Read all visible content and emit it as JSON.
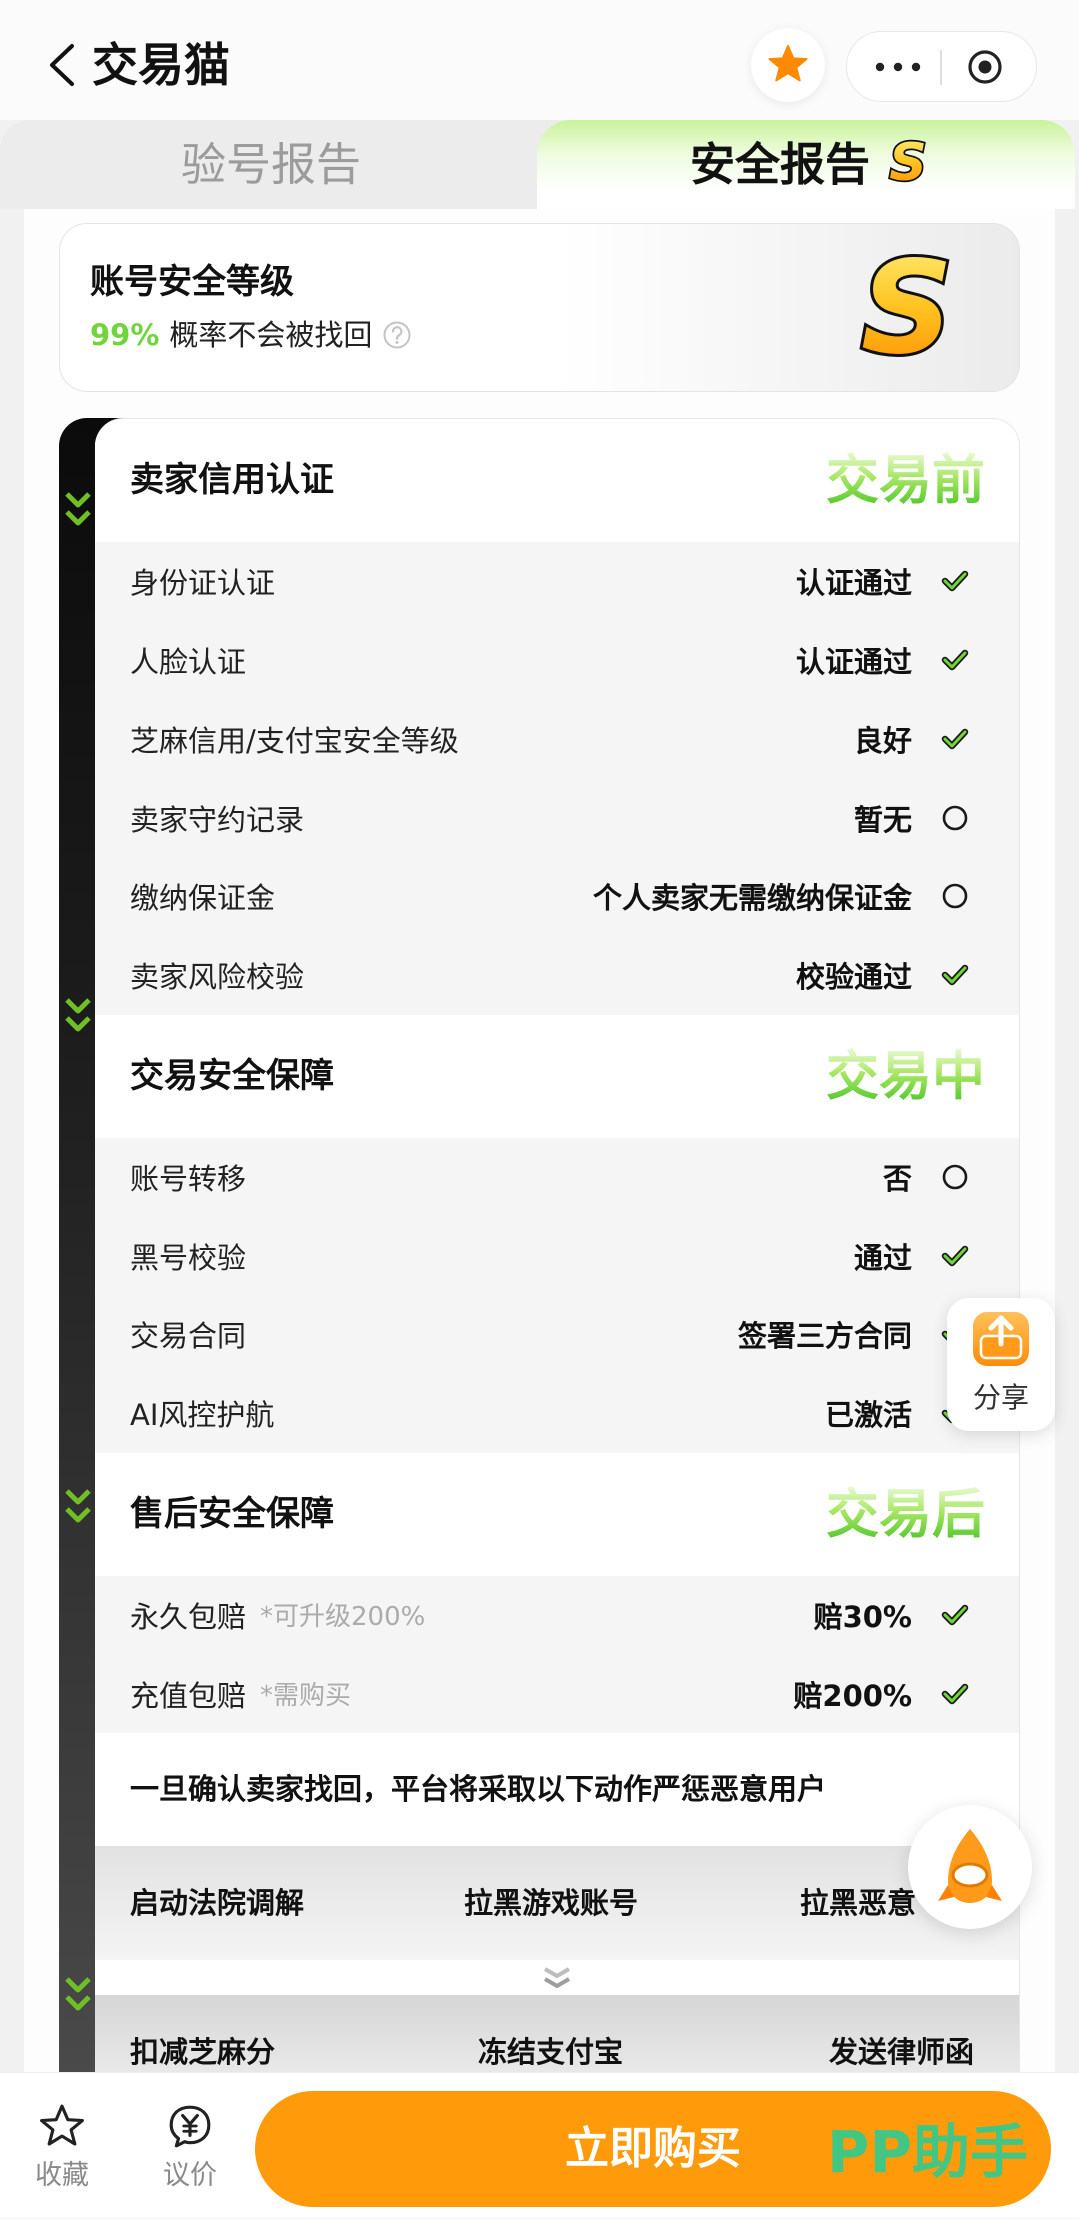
{
  "header": {
    "title": "交易猫"
  },
  "tabs": {
    "verify": "验号报告",
    "security": "安全报告",
    "security_badge": "S"
  },
  "level": {
    "title": "账号安全等级",
    "percent": "99%",
    "desc": "概率不会被找回",
    "grade": "S"
  },
  "sections": [
    {
      "title": "卖家信用认证",
      "stage": "交易前",
      "rows": [
        {
          "label": "身份证认证",
          "value": "认证通过",
          "icon": "check-icon"
        },
        {
          "label": "人脸认证",
          "value": "认证通过",
          "icon": "check-icon"
        },
        {
          "label": "芝麻信用/支付宝安全等级",
          "value": "良好",
          "icon": "check-icon"
        },
        {
          "label": "卖家守约记录",
          "value": "暂无",
          "icon": "circle-icon"
        },
        {
          "label": "缴纳保证金",
          "value": "个人卖家无需缴纳保证金",
          "icon": "circle-icon"
        },
        {
          "label": "卖家风险校验",
          "value": "校验通过",
          "icon": "check-icon"
        }
      ]
    },
    {
      "title": "交易安全保障",
      "stage": "交易中",
      "rows": [
        {
          "label": "账号转移",
          "value": "否",
          "icon": "circle-icon"
        },
        {
          "label": "黑号校验",
          "value": "通过",
          "icon": "check-icon"
        },
        {
          "label": "交易合同",
          "value": "签署三方合同",
          "icon": "check-icon"
        },
        {
          "label": "AI风控护航",
          "value": "已激活",
          "icon": "check-icon"
        }
      ]
    },
    {
      "title": "售后安全保障",
      "stage": "交易后",
      "rows": [
        {
          "label": "永久包赔",
          "note": "*可升级200%",
          "value": "赔30%",
          "icon": "check-icon"
        },
        {
          "label": "充值包赔",
          "note": "*需购买",
          "value": "赔200%",
          "icon": "check-icon"
        }
      ]
    }
  ],
  "penalty": {
    "intro": "一旦确认卖家找回，平台将采取以下动作严惩恶意用户",
    "actions": [
      "启动法院调解",
      "拉黑游戏账号",
      "拉黑恶意"
    ],
    "actions_more": [
      "扣减芝麻分",
      "冻结支付宝",
      "发送律师函"
    ]
  },
  "share": {
    "label": "分享"
  },
  "bottom": {
    "favorite": "收藏",
    "bargain": "议价",
    "buy": "立即购买"
  },
  "watermark": "PP助手",
  "colors": {
    "accent": "#ff9a0b",
    "success": "#72d43c",
    "stage_green": "#45c225",
    "stripe": "#0b0b0b"
  }
}
